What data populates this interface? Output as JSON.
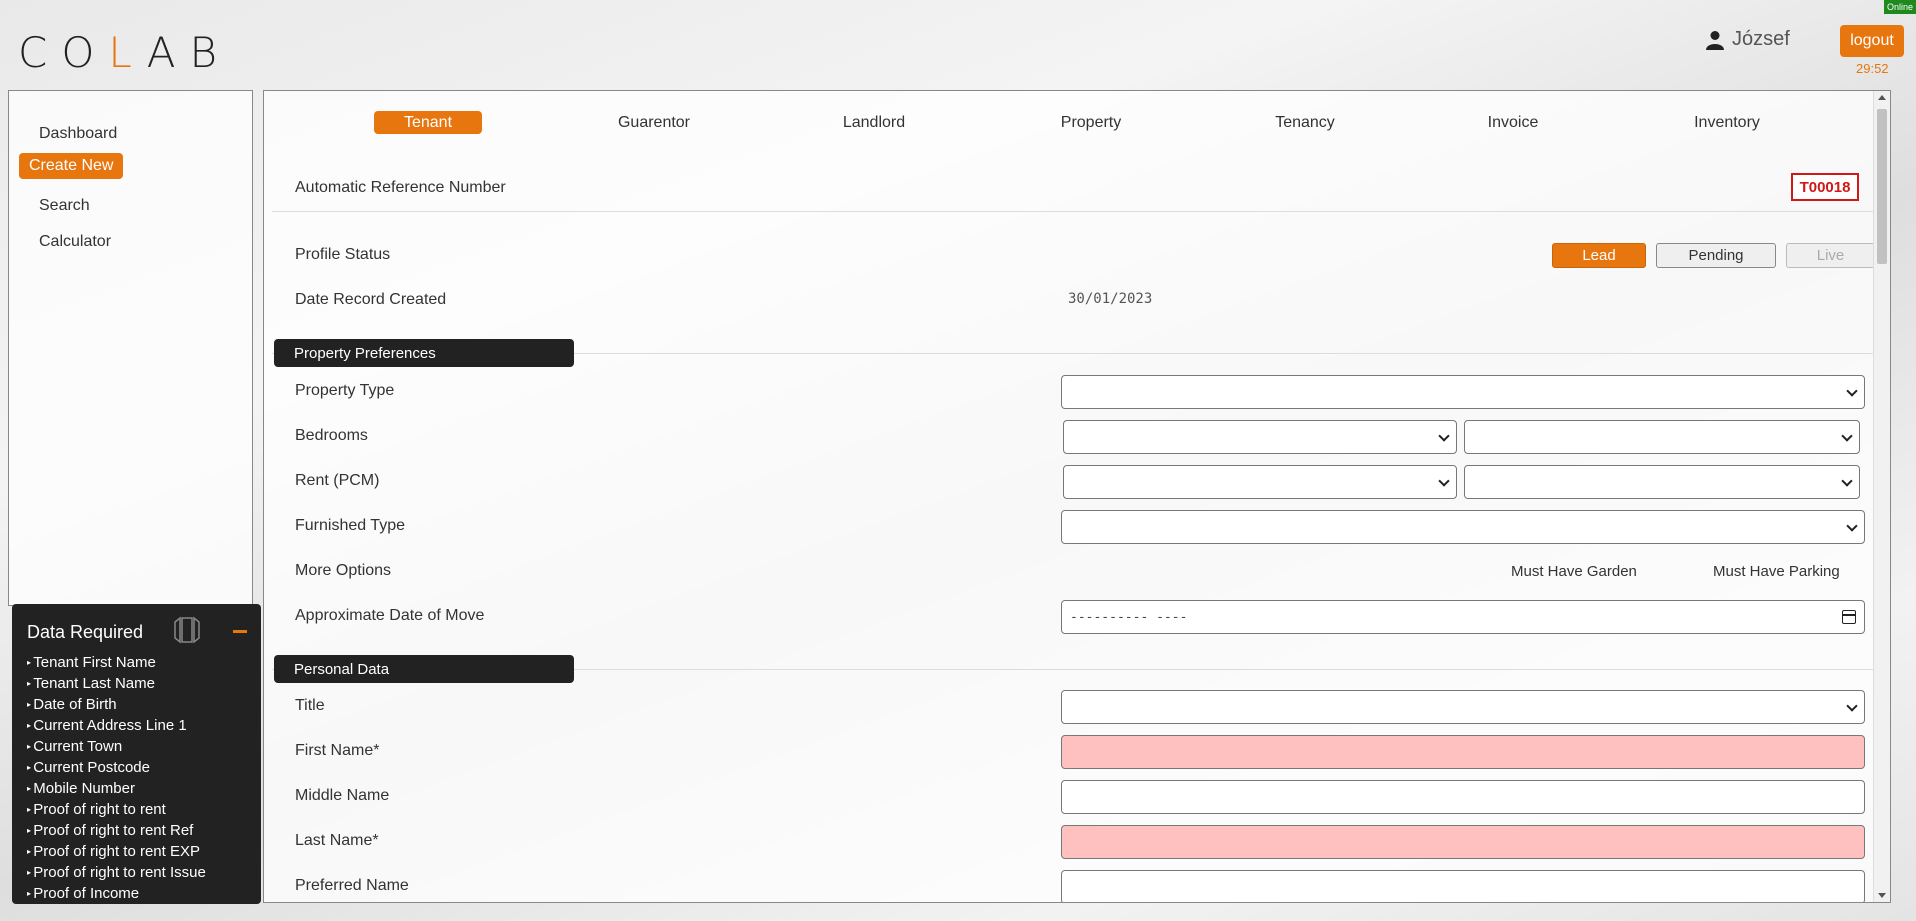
{
  "status": {
    "online": "Online"
  },
  "header": {
    "logo": {
      "prefix": "CO",
      "accent": "L",
      "suffix": "AB"
    },
    "username": "József",
    "logout_label": "logout",
    "timer": "29:52"
  },
  "sidebar": {
    "items": [
      {
        "label": "Dashboard"
      },
      {
        "label": "Create New"
      },
      {
        "label": "Search"
      },
      {
        "label": "Calculator"
      }
    ]
  },
  "data_required": {
    "title": "Data Required",
    "items": [
      "Tenant First Name",
      "Tenant Last Name",
      "Date of Birth",
      "Current Address Line 1",
      "Current Town",
      "Current Postcode",
      "Mobile Number",
      "Proof of right to rent",
      "Proof of right to rent Ref",
      "Proof of right to rent EXP",
      "Proof of right to rent Issue",
      "Proof of Income"
    ]
  },
  "tabs": [
    {
      "label": "Tenant"
    },
    {
      "label": "Guarentor"
    },
    {
      "label": "Landlord"
    },
    {
      "label": "Property"
    },
    {
      "label": "Tenancy"
    },
    {
      "label": "Invoice"
    },
    {
      "label": "Inventory"
    }
  ],
  "form": {
    "reference_label": "Automatic Reference Number",
    "reference_value": "T00018",
    "profile_status_label": "Profile Status",
    "status_options": [
      "Lead",
      "Pending",
      "Live"
    ],
    "date_created_label": "Date Record Created",
    "date_created_value": "30/01/2023",
    "property_preferences": {
      "title": "Property Preferences",
      "property_type": "Property Type",
      "bedrooms": "Bedrooms",
      "rent": "Rent (PCM)",
      "furnished_type": "Furnished Type",
      "more_options": "More Options",
      "must_have_garden": "Must Have Garden",
      "must_have_parking": "Must Have Parking",
      "move_date": "Approximate Date of Move",
      "move_date_value": "---------- ----"
    },
    "personal_data": {
      "title": "Personal Data",
      "title_field": "Title",
      "first_name": "First Name*",
      "middle_name": "Middle Name",
      "last_name": "Last Name*",
      "preferred_name": "Preferred Name"
    }
  }
}
